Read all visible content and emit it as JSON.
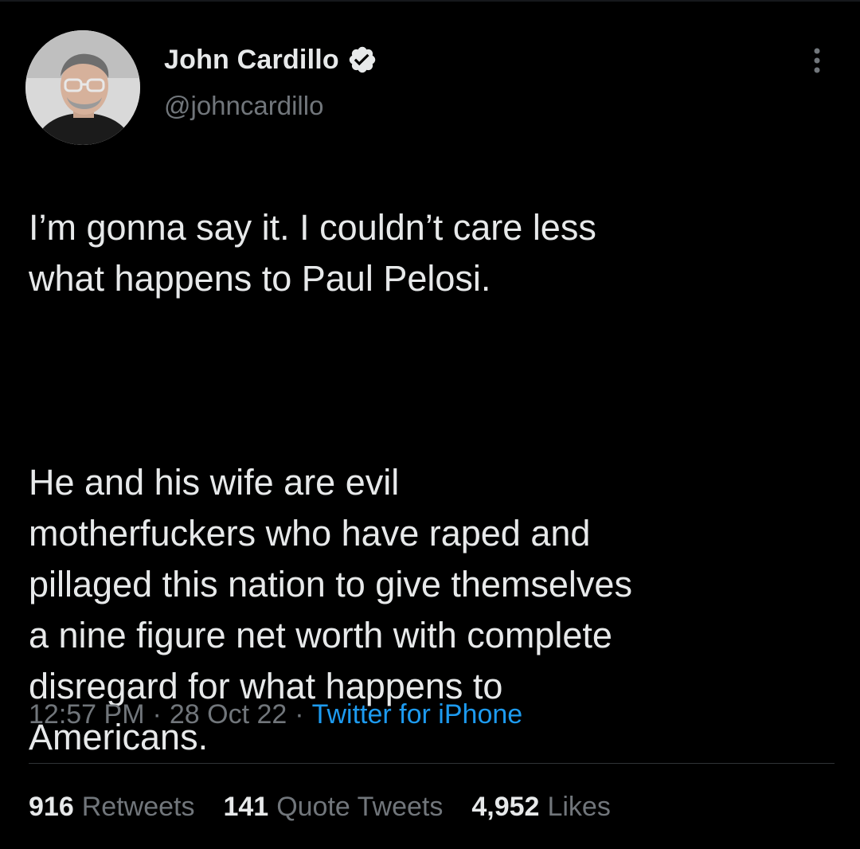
{
  "author": {
    "display_name": "John Cardillo",
    "handle": "@johncardillo",
    "verified": true,
    "verified_color": "#1d9bf0"
  },
  "tweet": {
    "paragraphs": [
      "I’m gonna say it. I couldn’t care less\nwhat happens to Paul Pelosi.",
      "He and his wife are evil\nmotherfuckers who have raped and\npillaged this nation to give themselves\na nine figure net worth with complete\ndisregard for what happens to\nAmericans."
    ]
  },
  "meta": {
    "time": "12:57 PM",
    "separator": "·",
    "date": "28 Oct 22",
    "source": "Twitter for iPhone"
  },
  "stats": {
    "retweets": {
      "count": "916",
      "label": "Retweets"
    },
    "quotes": {
      "count": "141",
      "label": "Quote Tweets"
    },
    "likes": {
      "count": "4,952",
      "label": "Likes"
    }
  },
  "colors": {
    "background": "#000000",
    "text": "#e7e9ea",
    "muted": "#71767b",
    "accent": "#1d9bf0",
    "divider": "#2f3336"
  },
  "icons": {
    "verified": "verified-badge-icon",
    "more": "more-dots-icon"
  }
}
